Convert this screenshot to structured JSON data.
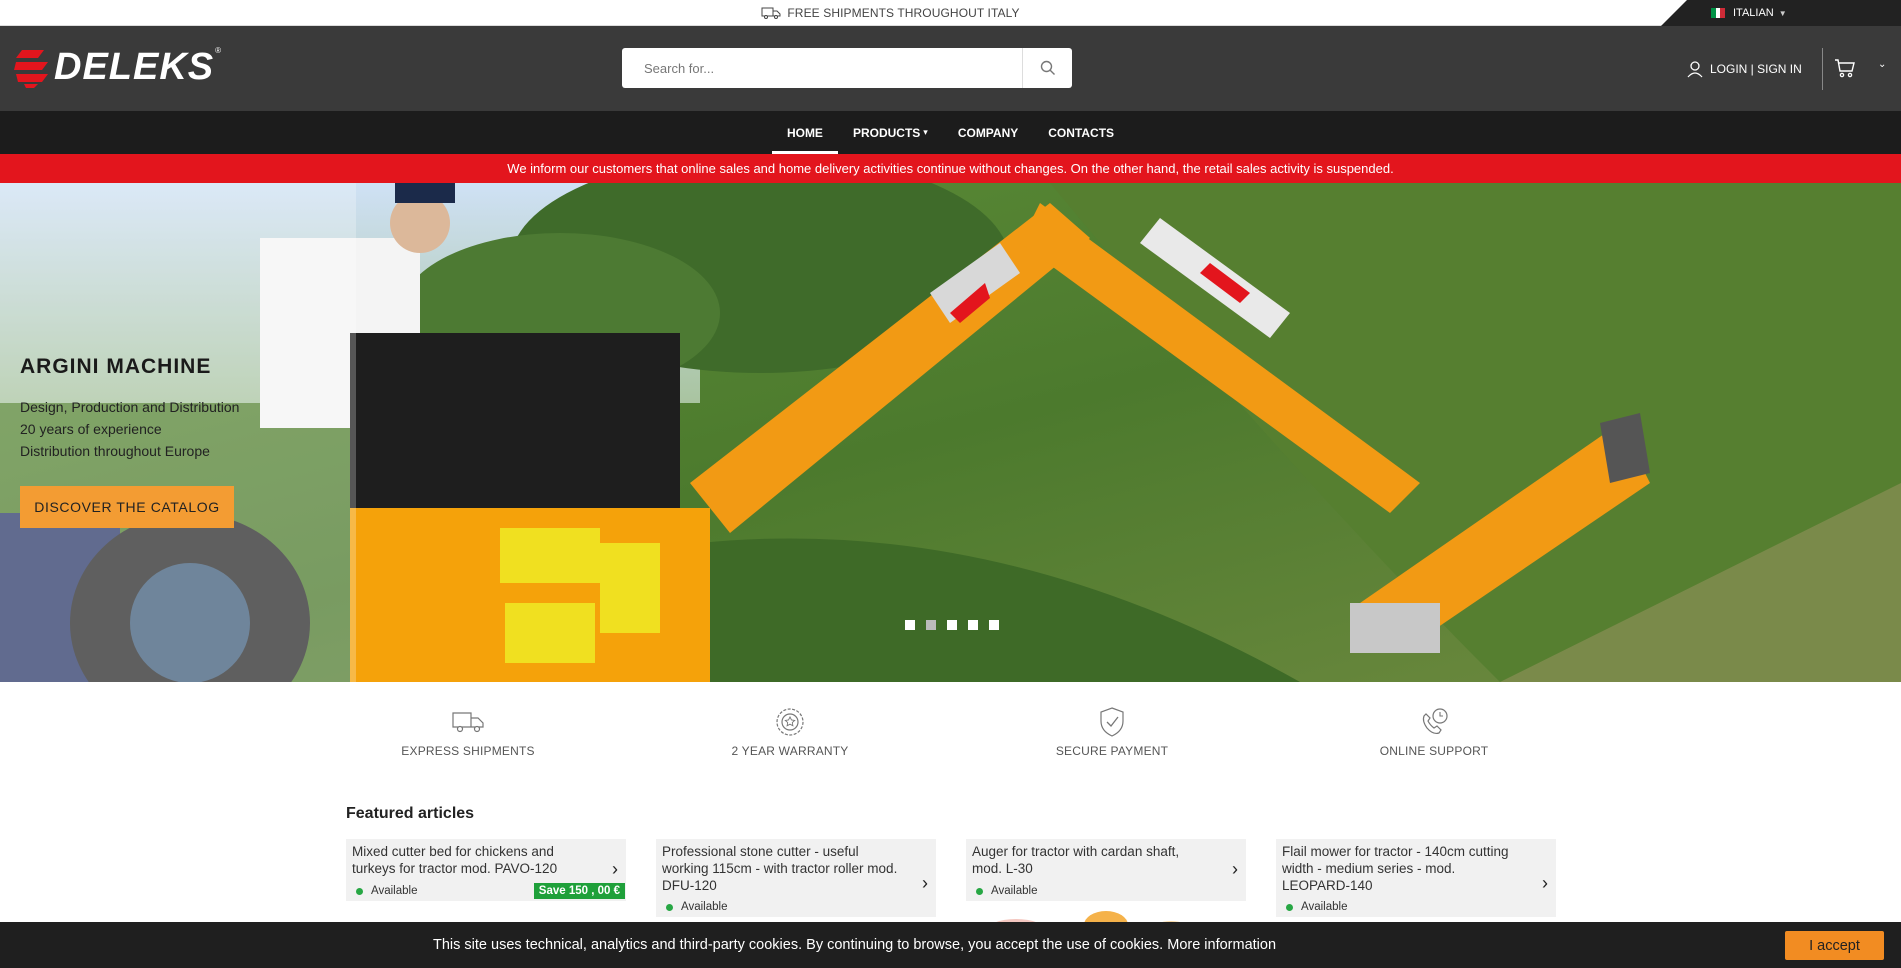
{
  "topbar": {
    "shipping_text": "FREE SHIPMENTS THROUGHOUT ITALY",
    "language": "ITALIAN",
    "shipping_icon": "truck-icon",
    "flag_colors": [
      "#009246",
      "#ffffff",
      "#ce2b37"
    ]
  },
  "header": {
    "logo_text": "DELEKS",
    "logo_reg": "®",
    "search_placeholder": "Search for...",
    "login_label": "LOGIN | SIGN IN",
    "icons": [
      "search-icon",
      "user-icon",
      "cart-icon",
      "chevron-down-icon"
    ]
  },
  "nav": {
    "items": [
      {
        "label": "HOME",
        "active": true
      },
      {
        "label": "PRODUCTS",
        "dropdown": true
      },
      {
        "label": "COMPANY"
      },
      {
        "label": "CONTACTS"
      }
    ]
  },
  "notice": {
    "text": "We inform our customers that online sales and home delivery activities continue without changes. On the other hand, the retail sales activity is suspended.",
    "color": "#e3151d"
  },
  "hero": {
    "title": "ARGINI MACHINE",
    "lines": [
      "Design, Production and Distribution",
      "20 years of experience",
      "Distribution throughout Europe"
    ],
    "cta": "DISCOVER THE CATALOG",
    "cta_color": "#f39c33",
    "slides_total": 5,
    "active_slide": 2
  },
  "features": [
    {
      "label": "EXPRESS SHIPMENTS",
      "icon": "truck-icon"
    },
    {
      "label": "2 YEAR WARRANTY",
      "icon": "badge-icon"
    },
    {
      "label": "SECURE PAYMENT",
      "icon": "shield-check-icon"
    },
    {
      "label": "ONLINE SUPPORT",
      "icon": "phone-support-icon"
    }
  ],
  "featured": {
    "title": "Featured articles",
    "items": [
      {
        "name": "Mixed cutter bed for chickens and turkeys for tractor mod. PAVO-120",
        "status": "Available",
        "badge": "Save 150 , 00 €"
      },
      {
        "name": "Professional stone cutter - useful working 115cm - with tractor roller mod. DFU-120",
        "status": "Available"
      },
      {
        "name": "Auger for tractor with cardan shaft, mod. L-30",
        "status": "Available"
      },
      {
        "name": "Flail mower for tractor - 140cm cutting width - medium series - mod. LEOPARD-140",
        "status": "Available"
      }
    ]
  },
  "cookie": {
    "text": "This site uses technical, analytics and third-party cookies. By continuing to browse, you accept the use of cookies. More information",
    "accept": "I accept",
    "accept_color": "#f28c22"
  }
}
